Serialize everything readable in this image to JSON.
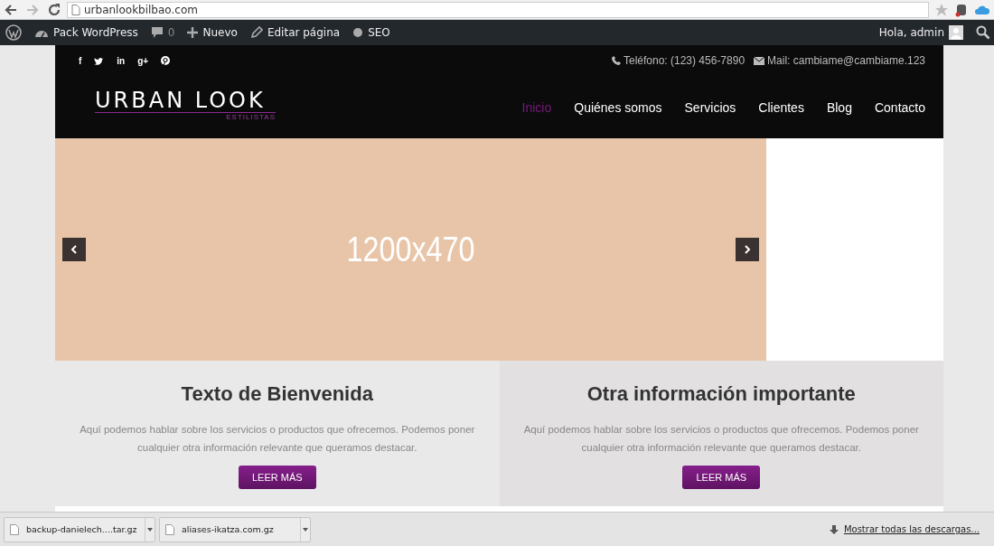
{
  "browser": {
    "url": "urbanlookbilbao.com",
    "forward_disabled": true
  },
  "admin_bar": {
    "site": "Pack WordPress",
    "comments": "0",
    "new": "Nuevo",
    "edit": "Editar página",
    "seo": "SEO",
    "greeting": "Hola, admin"
  },
  "header": {
    "social": [
      {
        "kind": "glyph",
        "text": "f"
      },
      {
        "kind": "bird"
      },
      {
        "kind": "glyph",
        "text": "in"
      },
      {
        "kind": "glyph",
        "text": "g+"
      },
      {
        "kind": "pin"
      }
    ],
    "phone": "Teléfono: (123) 456-7890",
    "mail": "Mail: cambiame@cambiame.123",
    "logo": {
      "title": "URBAN LOOK",
      "subtitle": "ESTILISTAS"
    },
    "nav": [
      {
        "label": "Inicio",
        "selected": true
      },
      {
        "label": "Quiénes somos",
        "selected": false
      },
      {
        "label": "Servicios",
        "selected": false
      },
      {
        "label": "Clientes",
        "selected": false
      },
      {
        "label": "Blog",
        "selected": false
      },
      {
        "label": "Contacto",
        "selected": false
      }
    ]
  },
  "slider": {
    "caption": "1200x470"
  },
  "boxes": [
    {
      "title": "Texto de Bienvenida",
      "text": "Aquí podemos hablar sobre los servicios o productos que ofrecemos. Podemos poner cualquier otra información relevante que queramos destacar.",
      "button": "LEER MÁS"
    },
    {
      "title": "Otra información importante",
      "text": "Aquí podemos hablar sobre los servicios o productos que ofrecemos. Podemos poner cualquier otra información relevante que queramos destacar.",
      "button": "LEER MÁS"
    }
  ],
  "downloads": {
    "items": [
      "backup-danielech....tar.gz",
      "aliases-ikatza.com.gz"
    ],
    "show_all": "Mostrar todas las descargas..."
  }
}
